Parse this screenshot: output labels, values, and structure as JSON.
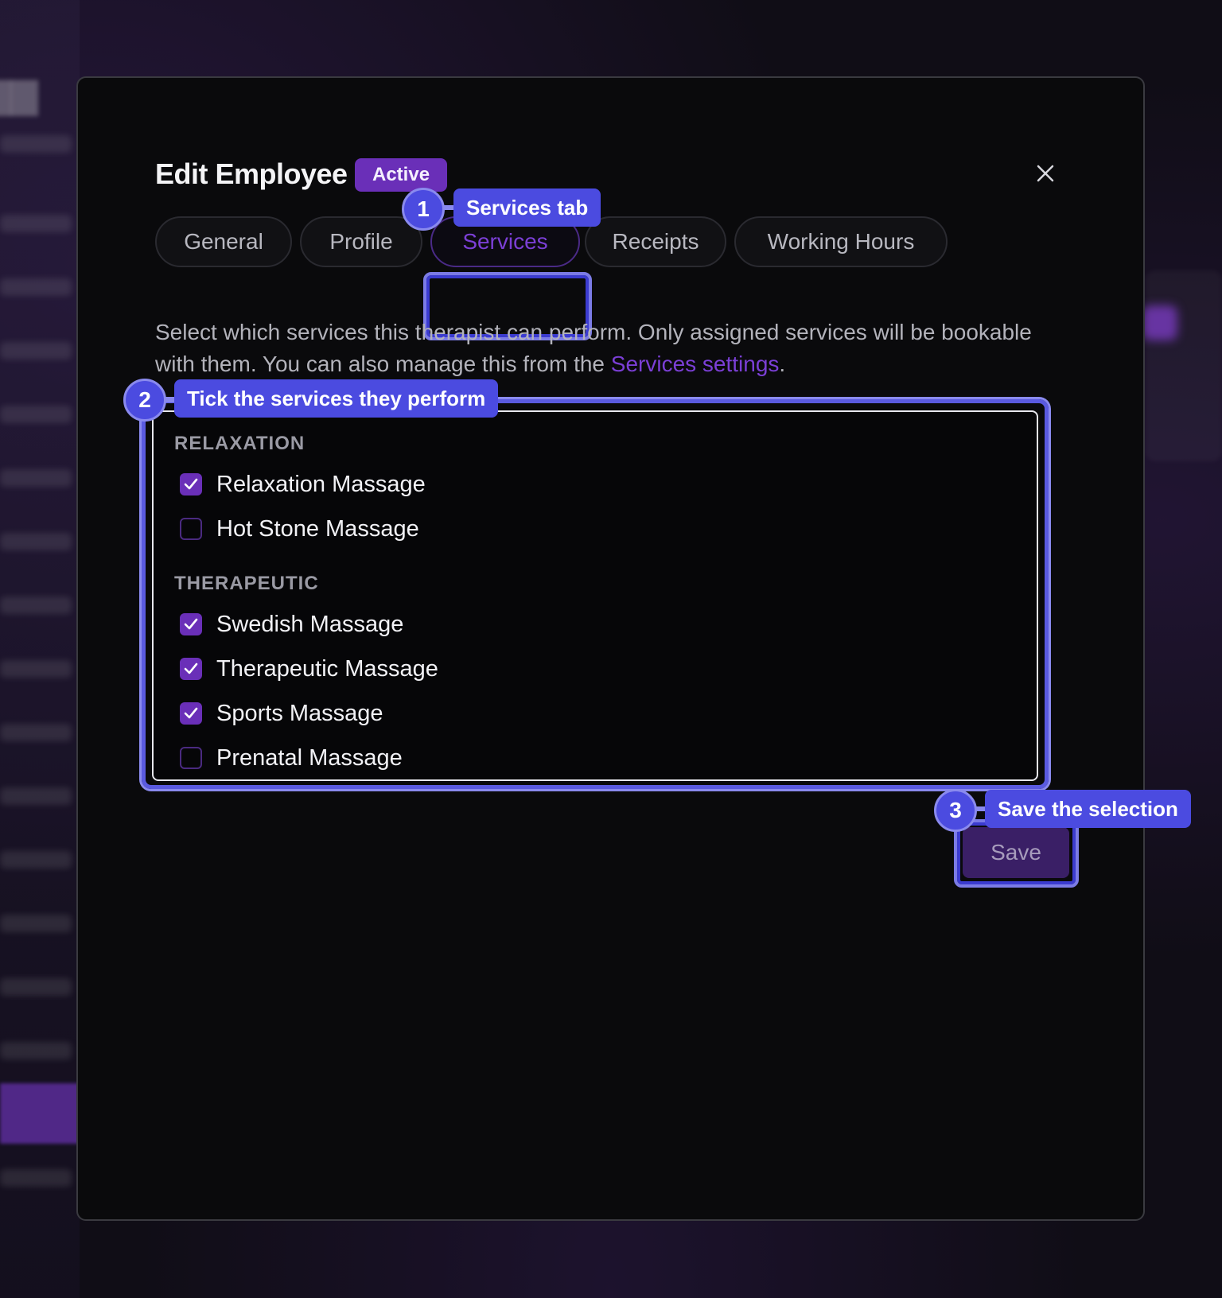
{
  "modal": {
    "title": "Edit Employee",
    "status_badge": "Active"
  },
  "tabs": [
    {
      "label": "General",
      "selected": false
    },
    {
      "label": "Profile",
      "selected": false
    },
    {
      "label": "Services",
      "selected": true
    },
    {
      "label": "Receipts",
      "selected": false
    },
    {
      "label": "Working Hours",
      "selected": false
    }
  ],
  "description": {
    "text": "Select which services this therapist can perform. Only assigned services will be bookable with them. You can also manage this from the ",
    "link": "Services settings",
    "suffix": "."
  },
  "service_groups": [
    {
      "label": "RELAXATION",
      "services": [
        {
          "name": "Relaxation Massage",
          "checked": true
        },
        {
          "name": "Hot Stone Massage",
          "checked": false
        }
      ]
    },
    {
      "label": "THERAPEUTIC",
      "services": [
        {
          "name": "Swedish Massage",
          "checked": true
        },
        {
          "name": "Therapeutic Massage",
          "checked": true
        },
        {
          "name": "Sports Massage",
          "checked": true
        },
        {
          "name": "Prenatal Massage",
          "checked": false
        }
      ]
    }
  ],
  "save_button": "Save",
  "annotations": [
    {
      "number": "1",
      "label": "Services tab"
    },
    {
      "number": "2",
      "label": "Tick the services they perform"
    },
    {
      "number": "3",
      "label": "Save the selection"
    }
  ],
  "colors": {
    "accent": "#6a2fb8",
    "annotation": "#4b4be0",
    "modal_bg": "#0a0a0c"
  }
}
